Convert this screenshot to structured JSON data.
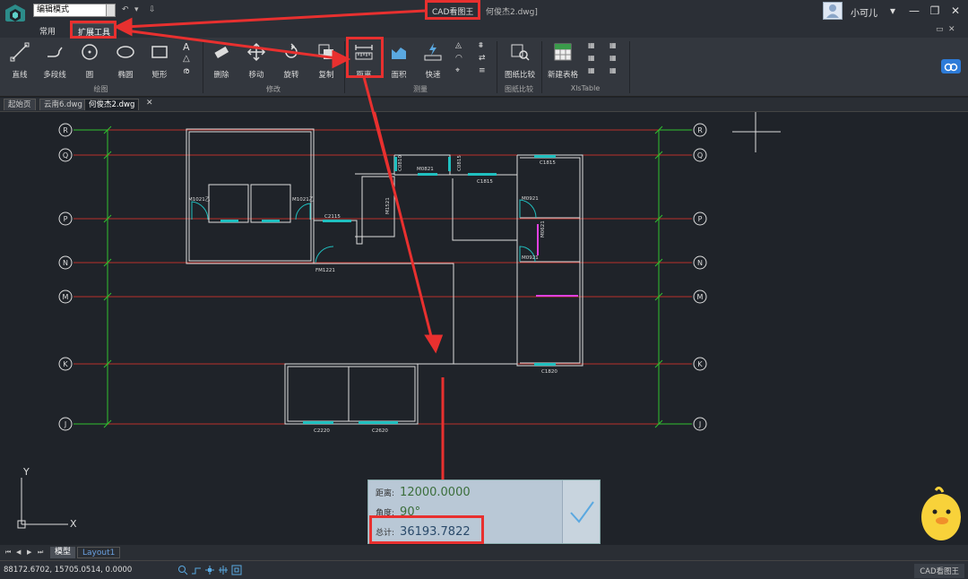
{
  "titlebar": {
    "mode_select": "编辑模式",
    "app_name": "CAD看图王",
    "file_name": "何俊杰2.dwg]",
    "user_name": "小可儿"
  },
  "menu": {
    "tabs": [
      "常用",
      "扩展工具"
    ]
  },
  "ribbon": {
    "tools": {
      "line": "直线",
      "polyline": "多段线",
      "circle": "圆",
      "ellipse": "椭圆",
      "rect": "矩形",
      "delete": "删除",
      "move": "移动",
      "rotate": "旋转",
      "copy": "复制",
      "distance": "距离",
      "area": "面积",
      "quick": "快速",
      "compare": "图纸比较",
      "new_table": "新建表格"
    },
    "groups": {
      "draw": "绘图",
      "modify": "修改",
      "measure": "测量",
      "compare": "图纸比较",
      "xlstable": "XlsTable"
    }
  },
  "doc_tabs": [
    "起始页",
    "云南6.dwg",
    "何俊杰2.dwg"
  ],
  "drawing": {
    "axis_labels": [
      "R",
      "Q",
      "P",
      "N",
      "M",
      "K",
      "J"
    ],
    "labels": {
      "m1021_left": "M1021乙",
      "m1021_right": "M1021乙",
      "c2115": "C2115",
      "m0821": "M0821",
      "m1521": "M1521",
      "c1815_left": "C1815",
      "c1815_right": "C1815",
      "m0921_a": "M0921",
      "m0921_b": "M0921",
      "m0621": "M0621",
      "fm1221": "FM1221",
      "c1820": "C1820",
      "c2220": "C2220",
      "c2620": "C2620",
      "c0810": "C0810",
      "c0815": "C0815"
    },
    "ucs": {
      "y": "Y",
      "x": "X"
    }
  },
  "measure": {
    "distance_label": "距离:",
    "distance_value": "12000.0000",
    "angle_label": "角度:",
    "angle_value": "90°",
    "total_label": "总计:",
    "total_value": "36193.7822"
  },
  "layout": {
    "tabs": [
      "模型",
      "Layout1"
    ]
  },
  "status": {
    "coords": "88172.6702, 15705.0514, 0.0000",
    "brand": "CAD看图王"
  },
  "colors": {
    "accent": "#e8302f",
    "axis_red": "#c0302a",
    "axis_green": "#30c030",
    "cyan": "#20c0c0"
  }
}
